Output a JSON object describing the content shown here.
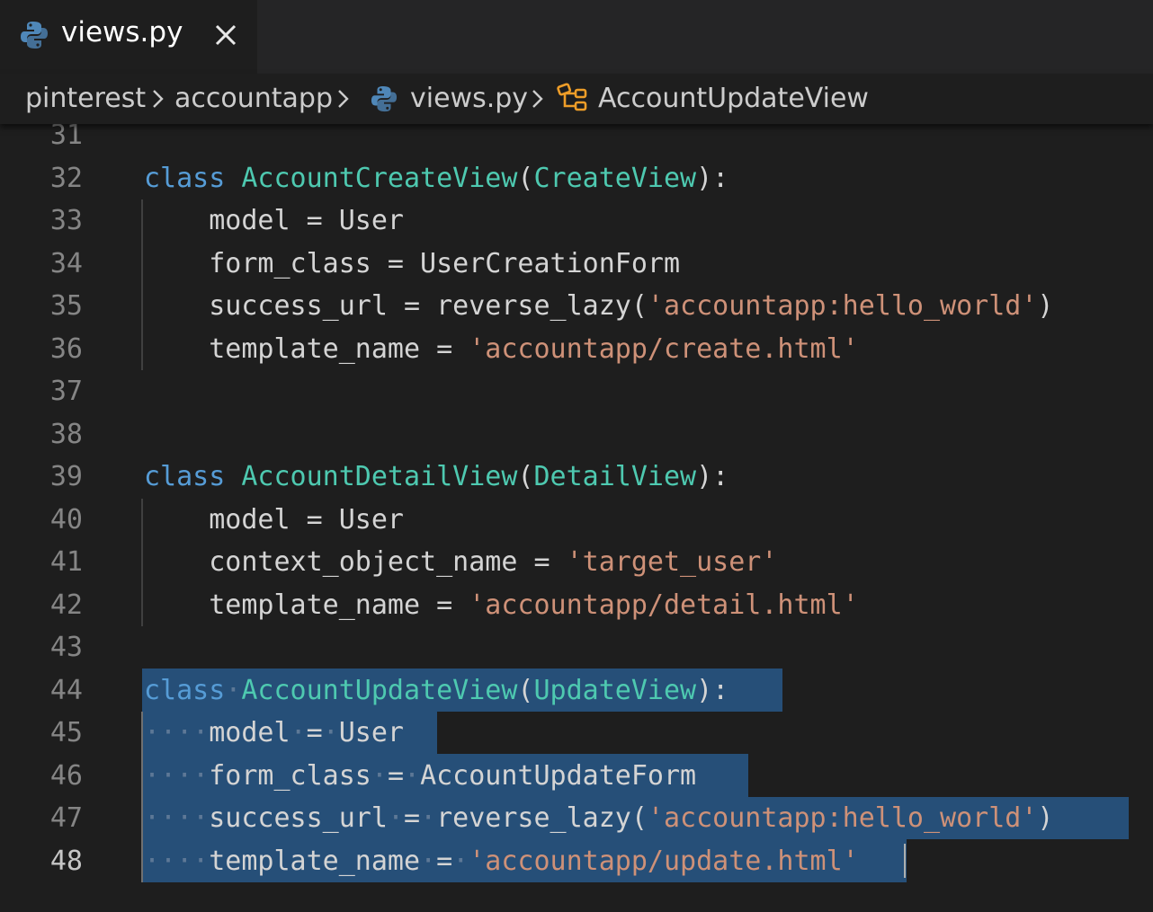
{
  "tab": {
    "label": "views.py",
    "icon": "python-file-icon",
    "close_icon": "close-icon"
  },
  "breadcrumb": {
    "items": [
      "pinterest",
      "accountapp",
      "views.py",
      "AccountUpdateView"
    ],
    "separator_icon": "chevron-right-icon",
    "file_icon": "python-file-icon",
    "symbol_icon": "class-symbol-icon"
  },
  "colors": {
    "keyword": "#569cd6",
    "class_name": "#4ec9b0",
    "string": "#ce9178",
    "text": "#d4d4d4",
    "line_number": "#858585",
    "selection": "#264f78",
    "editor_background": "#1e1e1e"
  },
  "editor": {
    "current_line": "48",
    "lines": [
      {
        "n": "31",
        "tokens": []
      },
      {
        "n": "32",
        "tokens": [
          [
            "kw",
            "class"
          ],
          [
            "plain",
            " "
          ],
          [
            "cls",
            "AccountCreateView"
          ],
          [
            "plain",
            "("
          ],
          [
            "cls",
            "CreateView"
          ],
          [
            "plain",
            "):"
          ]
        ]
      },
      {
        "n": "33",
        "tokens": [
          [
            "plain",
            "    model = User"
          ]
        ]
      },
      {
        "n": "34",
        "tokens": [
          [
            "plain",
            "    form_class = UserCreationForm"
          ]
        ]
      },
      {
        "n": "35",
        "tokens": [
          [
            "plain",
            "    success_url = reverse_lazy("
          ],
          [
            "str",
            "'accountapp:hello_world'"
          ],
          [
            "plain",
            ")"
          ]
        ]
      },
      {
        "n": "36",
        "tokens": [
          [
            "plain",
            "    template_name = "
          ],
          [
            "str",
            "'accountapp/create.html'"
          ]
        ]
      },
      {
        "n": "37",
        "tokens": []
      },
      {
        "n": "38",
        "tokens": []
      },
      {
        "n": "39",
        "tokens": [
          [
            "kw",
            "class"
          ],
          [
            "plain",
            " "
          ],
          [
            "cls",
            "AccountDetailView"
          ],
          [
            "plain",
            "("
          ],
          [
            "cls",
            "DetailView"
          ],
          [
            "plain",
            "):"
          ]
        ]
      },
      {
        "n": "40",
        "tokens": [
          [
            "plain",
            "    model = User"
          ]
        ]
      },
      {
        "n": "41",
        "tokens": [
          [
            "plain",
            "    context_object_name = "
          ],
          [
            "str",
            "'target_user'"
          ]
        ]
      },
      {
        "n": "42",
        "tokens": [
          [
            "plain",
            "    template_name = "
          ],
          [
            "str",
            "'accountapp/detail.html'"
          ]
        ]
      },
      {
        "n": "43",
        "tokens": []
      },
      {
        "n": "44",
        "tokens": [
          [
            "kw",
            "class"
          ],
          [
            "ws",
            "·"
          ],
          [
            "cls",
            "AccountUpdateView"
          ],
          [
            "plain",
            "("
          ],
          [
            "cls",
            "UpdateView"
          ],
          [
            "plain",
            "):"
          ]
        ]
      },
      {
        "n": "45",
        "tokens": [
          [
            "ws",
            "····"
          ],
          [
            "plain",
            "model"
          ],
          [
            "ws",
            "·"
          ],
          [
            "plain",
            "="
          ],
          [
            "ws",
            "·"
          ],
          [
            "plain",
            "User"
          ]
        ]
      },
      {
        "n": "46",
        "tokens": [
          [
            "ws",
            "····"
          ],
          [
            "plain",
            "form_class"
          ],
          [
            "ws",
            "·"
          ],
          [
            "plain",
            "="
          ],
          [
            "ws",
            "·"
          ],
          [
            "plain",
            "AccountUpdateForm"
          ]
        ]
      },
      {
        "n": "47",
        "tokens": [
          [
            "ws",
            "····"
          ],
          [
            "plain",
            "success_url"
          ],
          [
            "ws",
            "·"
          ],
          [
            "plain",
            "="
          ],
          [
            "ws",
            "·"
          ],
          [
            "plain",
            "reverse_lazy("
          ],
          [
            "str",
            "'accountapp:hello_world'"
          ],
          [
            "plain",
            ")"
          ]
        ]
      },
      {
        "n": "48",
        "tokens": [
          [
            "ws",
            "····"
          ],
          [
            "plain",
            "template_name"
          ],
          [
            "ws",
            "·"
          ],
          [
            "plain",
            "="
          ],
          [
            "ws",
            "·"
          ],
          [
            "str",
            "'accountapp/update.html'"
          ]
        ]
      }
    ]
  }
}
